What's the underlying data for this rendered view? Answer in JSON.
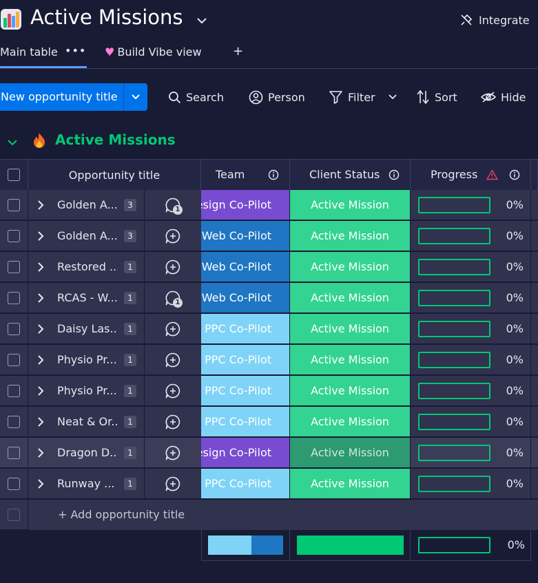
{
  "header": {
    "title": "Active Missions",
    "integrate_label": "Integrate"
  },
  "tabs": [
    {
      "label": "Main table",
      "active": true
    },
    {
      "label": "Build Vibe view",
      "active": false
    }
  ],
  "toolbar": {
    "new_button_label": "New opportunity title",
    "search_label": "Search",
    "person_label": "Person",
    "filter_label": "Filter",
    "sort_label": "Sort",
    "hide_label": "Hide"
  },
  "group": {
    "title": "Active Missions",
    "color": "#00c875"
  },
  "columns": {
    "title": "Opportunity title",
    "team": "Team",
    "status": "Client Status",
    "progress": "Progress"
  },
  "colors": {
    "design": "#784bd1",
    "web": "#1f76c2",
    "ppc": "#7fd3f7",
    "active": "#33d391",
    "accent": "#0073ea"
  },
  "rows": [
    {
      "title": "Golden A...",
      "subitems": "3",
      "update_count": "1",
      "team": "Design Co-Pilot",
      "team_color": "#784bd1",
      "status": "Active Mission",
      "progress": "0%",
      "progress_value": 0
    },
    {
      "title": "Golden A...",
      "subitems": "3",
      "update_count": "",
      "team": "Web Co-Pilot",
      "team_color": "#1f76c2",
      "status": "Active Mission",
      "progress": "0%",
      "progress_value": 0
    },
    {
      "title": "Restored ...",
      "subitems": "1",
      "update_count": "",
      "team": "Web Co-Pilot",
      "team_color": "#1f76c2",
      "status": "Active Mission",
      "progress": "0%",
      "progress_value": 0
    },
    {
      "title": "RCAS - W...",
      "subitems": "1",
      "update_count": "1",
      "team": "Web Co-Pilot",
      "team_color": "#1f76c2",
      "status": "Active Mission",
      "progress": "0%",
      "progress_value": 0
    },
    {
      "title": "Daisy Las...",
      "subitems": "1",
      "update_count": "",
      "team": "PPC Co-Pilot",
      "team_color": "#7fd3f7",
      "status": "Active Mission",
      "progress": "0%",
      "progress_value": 0
    },
    {
      "title": "Physio Pr...",
      "subitems": "1",
      "update_count": "",
      "team": "PPC Co-Pilot",
      "team_color": "#7fd3f7",
      "status": "Active Mission",
      "progress": "0%",
      "progress_value": 0
    },
    {
      "title": "Physio Pr...",
      "subitems": "1",
      "update_count": "",
      "team": "PPC Co-Pilot",
      "team_color": "#7fd3f7",
      "status": "Active Mission",
      "progress": "0%",
      "progress_value": 0
    },
    {
      "title": "Neat & Or...",
      "subitems": "1",
      "update_count": "",
      "team": "PPC Co-Pilot",
      "team_color": "#7fd3f7",
      "status": "Active Mission",
      "progress": "0%",
      "progress_value": 0
    },
    {
      "title": "Dragon D...",
      "subitems": "1",
      "update_count": "",
      "team": "Design Co-Pilot",
      "team_color": "#784bd1",
      "status": "Active Mission",
      "progress": "0%",
      "progress_value": 0,
      "hover": true
    },
    {
      "title": "Runway ...",
      "subitems": "1",
      "update_count": "",
      "team": "PPC Co-Pilot",
      "team_color": "#7fd3f7",
      "status": "Active Mission",
      "progress": "0%",
      "progress_value": 0
    }
  ],
  "add_row_label": "+ Add opportunity title",
  "summary": {
    "team_split": [
      {
        "color": "#7fd3f7",
        "fraction": 0.58
      },
      {
        "color": "#1f76c2",
        "fraction": 0.42
      }
    ],
    "progress": "0%"
  }
}
